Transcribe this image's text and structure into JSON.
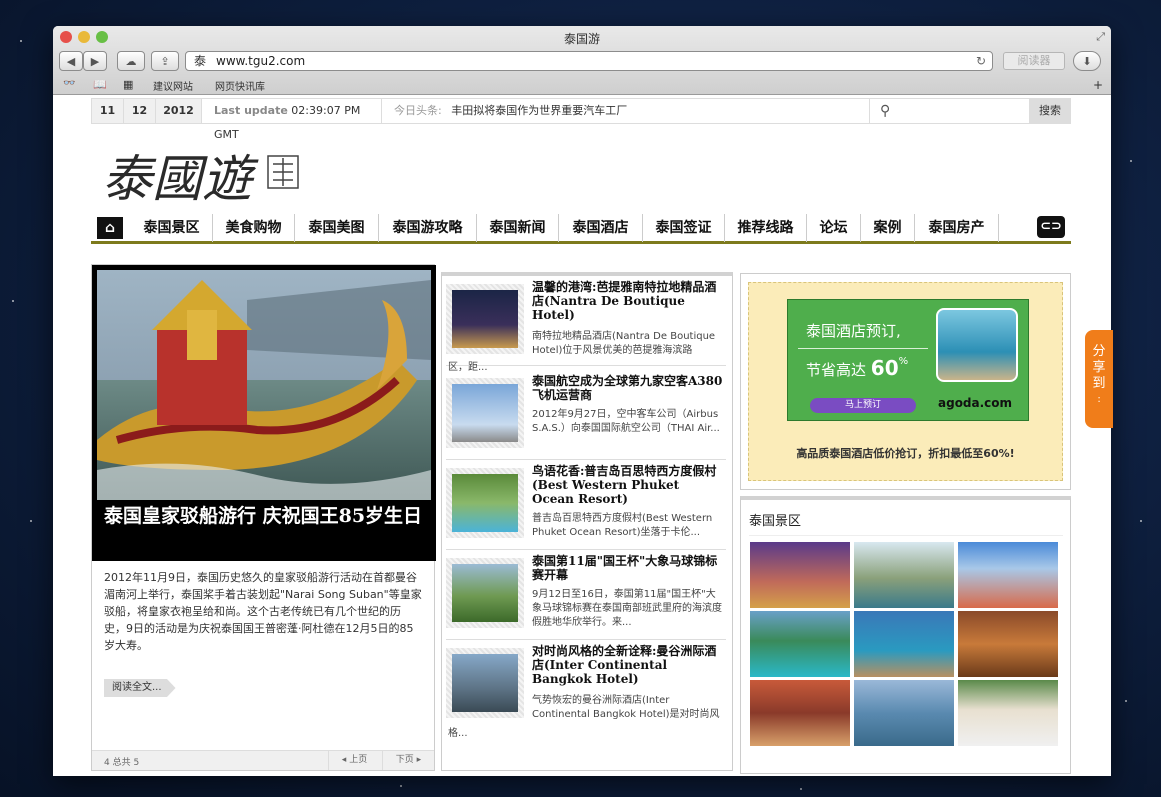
{
  "browser": {
    "window_title": "泰国游",
    "url": "www.tgu2.com",
    "reader_label": "阅读器",
    "bookmarks": [
      "建议网站",
      "网页快讯库"
    ]
  },
  "topbar": {
    "month": "11",
    "day": "12",
    "year": "2012",
    "last_update_label": "Last update",
    "last_update_time": "02:39:07 PM GMT",
    "headline_label": "今日头条:",
    "headline": "丰田拟将泰国作为世界重要汽车工厂",
    "search_button": "搜索"
  },
  "nav": {
    "items": [
      "泰国景区",
      "美食购物",
      "泰国美图",
      "泰国游攻略",
      "泰国新闻",
      "泰国酒店",
      "泰国签证",
      "推荐线路",
      "论坛",
      "案例",
      "泰国房产"
    ]
  },
  "featured": {
    "title": "泰国皇家驳船游行 庆祝国王85岁生日",
    "text": "2012年11月9日，泰国历史悠久的皇家驳船游行活动在首都曼谷湄南河上举行，泰国桨手着古装划起\"Narai Song Suban\"等皇家驳船，将皇家衣袍呈给和尚。这个古老传统已有几个世纪的历史，9日的活动是为庆祝泰国国王普密蓬·阿杜德在12月5日的85岁大寿。",
    "read_more": "阅读全文...",
    "pager_info": "4 总共 5",
    "prev": "上页",
    "next": "下页"
  },
  "news": [
    {
      "title": "温馨的港湾:芭提雅南特拉地精品酒店(Nantra De Boutique Hotel)",
      "desc": "南特拉地精品酒店(Nantra De Boutique Hotel)位于风景优美的芭提雅海滨路",
      "desc2": "区，距..."
    },
    {
      "title": "泰国航空成为全球第九家空客A380飞机运营商",
      "desc": "2012年9月27日，空中客车公司（Airbus S.A.S.）向泰国国际航空公司（THAI Air...",
      "desc2": ""
    },
    {
      "title": "鸟语花香:普吉岛百思特西方度假村(Best Western Phuket Ocean Resort)",
      "desc": "普吉岛百思特西方度假村(Best Western Phuket Ocean Resort)坐落于卡伦...",
      "desc2": ""
    },
    {
      "title": "泰国第11届\"国王杯\"大象马球锦标赛开幕",
      "desc": "9月12日至16日，泰国第11届\"国王杯\"大象马球锦标赛在泰国南部班武里府的海滨度假胜地华欣举行。来...",
      "desc2": ""
    },
    {
      "title": "对时尚风格的全新诠释:曼谷洲际酒店(Inter Continental Bangkok Hotel)",
      "desc": "气势恢宏的曼谷洲际酒店(Inter Continental Bangkok Hotel)是对时尚风",
      "desc2": "格..."
    }
  ],
  "ad": {
    "line1": "泰国酒店预订,",
    "line2": "节省高达",
    "percent": "60",
    "percent_sign": "%",
    "button": "马上预订",
    "brand": "agoda.com",
    "caption": "高品质泰国酒店低价抢订，折扣最低至60%!"
  },
  "scenic": {
    "title": "泰国景区"
  },
  "share": {
    "label": "分享到"
  }
}
